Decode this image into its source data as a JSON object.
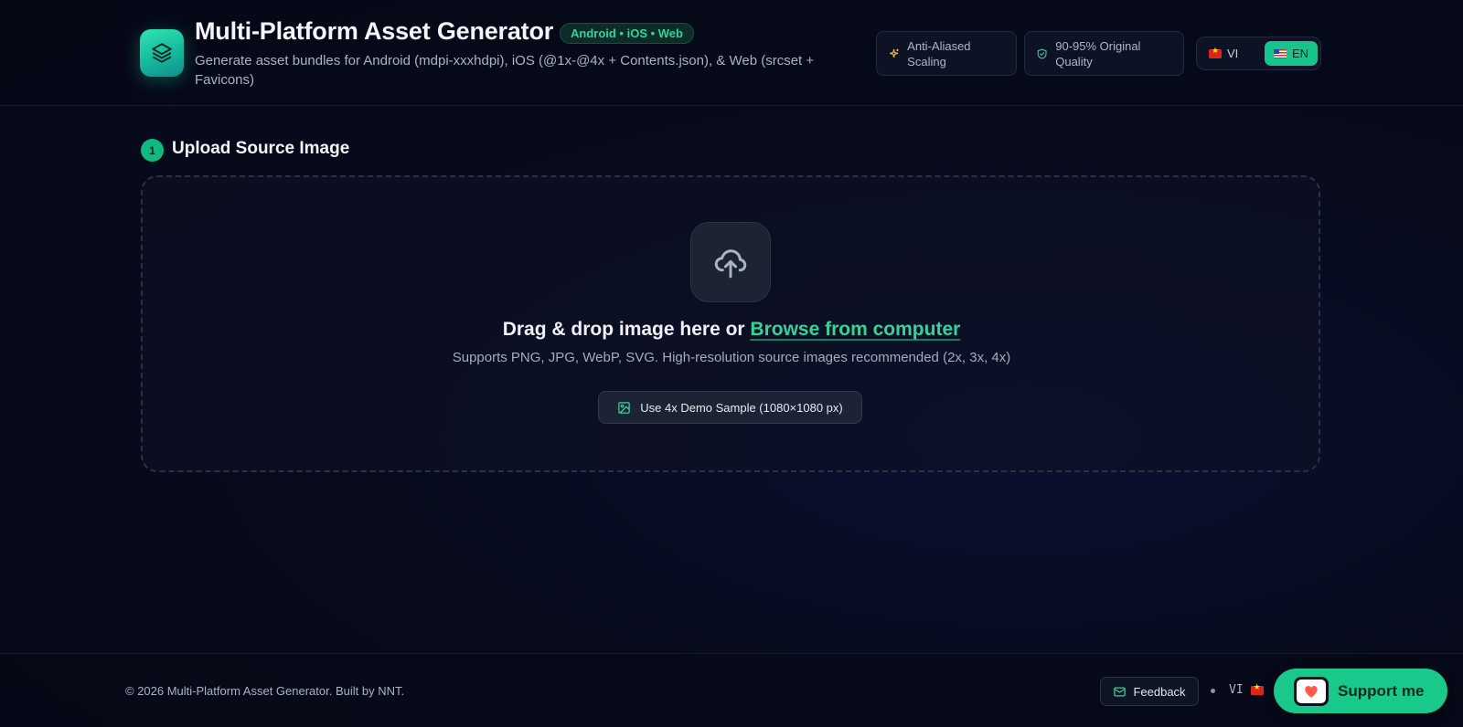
{
  "header": {
    "title": "Multi-Platform Asset Generator",
    "platform_badge": "Android • iOS • Web",
    "subtitle": "Generate asset bundles for Android (mdpi-xxxhdpi), iOS (@1x-@4x + Contents.json), & Web (srcset + Favicons)",
    "features": [
      {
        "label": "Anti-Aliased Scaling",
        "icon": "sparkle-icon"
      },
      {
        "label": "90-95% Original Quality",
        "icon": "shield-check-icon"
      }
    ],
    "language": {
      "options": [
        {
          "code": "VI",
          "flag": "vietnam-flag"
        },
        {
          "code": "EN",
          "flag": "us-flag"
        }
      ],
      "selected": "EN"
    }
  },
  "upload": {
    "step_number": "1",
    "section_title": "Upload Source Image",
    "drop_text": "Drag & drop image here or",
    "browse_link": "Browse from computer",
    "supports_text": "Supports PNG, JPG, WebP, SVG. High-resolution source images recommended (2x, 3x, 4x)",
    "demo_button": "Use 4x Demo Sample (1080×1080 px)"
  },
  "footer": {
    "copyright": "© 2026 Multi-Platform Asset Generator. Built by NNT.",
    "feedback": "Feedback",
    "language": "VI",
    "support": "Support me"
  },
  "colors": {
    "accent": "#10b981",
    "link": "#34d399",
    "background": "#070b1c",
    "feature_icon_1": "#f5b942",
    "feature_icon_2": "#34d399"
  }
}
